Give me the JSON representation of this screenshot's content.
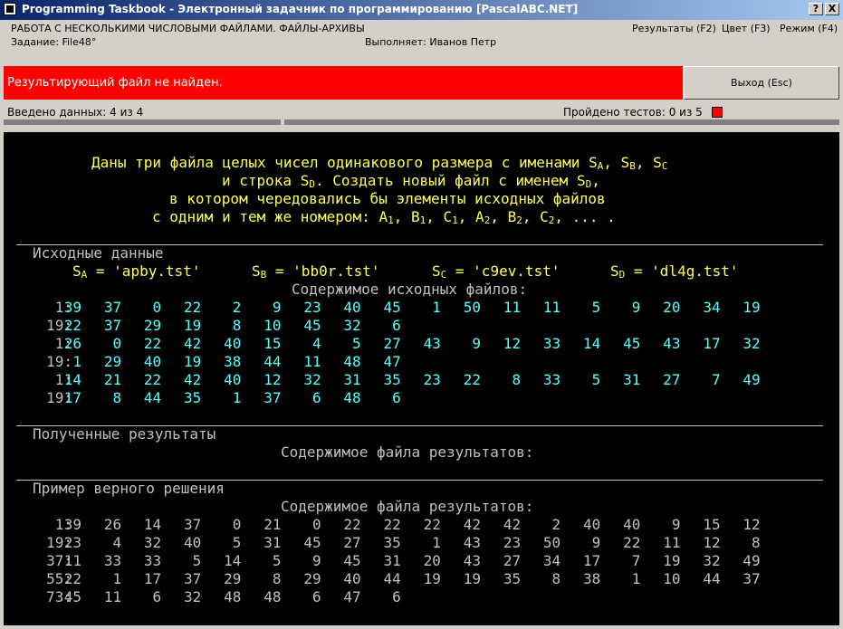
{
  "window": {
    "title": "Programming Taskbook - Электронный задачник по программированию [PascalABC.NET]",
    "help_btn": "?",
    "close_btn": "X"
  },
  "header": {
    "topic": "РАБОТА С НЕСКОЛЬКИМИ ЧИСЛОВЫМИ ФАЙЛАМИ. ФАЙЛЫ-АРХИВЫ",
    "task": "Задание: File48°",
    "performer": "Выполняет: Иванов Петр",
    "menu": [
      "Результаты (F2)",
      "Цвет (F3)",
      "Режим (F4)"
    ]
  },
  "message": "Результирующий файл не найден.",
  "exit_button": "Выход (Esc)",
  "status": {
    "entered": "Введено данных: 4 из 4",
    "tests": "Пройдено тестов: 0 из 5"
  },
  "task_text": [
    [
      "Даны три файла целых чисел одинакового размера с именами S",
      "A",
      ", S",
      "B",
      ", S",
      "C",
      ""
    ],
    [
      "и строка S",
      "D",
      ". Создать новый файл с именем S",
      "D",
      ","
    ],
    [
      "в котором чередовались бы элементы исходных файлов"
    ],
    [
      "с одним и тем же номером: A",
      "1",
      ", B",
      "1",
      ", C",
      "1",
      ", A",
      "2",
      ", B",
      "2",
      ", C",
      "2",
      ", ... ."
    ]
  ],
  "sections": {
    "source": "Исходные данные",
    "results": "Полученные результаты",
    "example": "Пример верного решения"
  },
  "file_names": [
    {
      "label": "S",
      "sub": "A",
      "eq": " = ",
      "value": "'apby.tst'"
    },
    {
      "label": "S",
      "sub": "B",
      "eq": " = ",
      "value": "'bb0r.tst'"
    },
    {
      "label": "S",
      "sub": "C",
      "eq": " = ",
      "value": "'c9ev.tst'"
    },
    {
      "label": "S",
      "sub": "D",
      "eq": " = ",
      "value": "'dl4g.tst'"
    }
  ],
  "source_caption": "Содержимое исходных файлов:",
  "source_rows": [
    {
      "label": "1:",
      "values": [
        "39",
        "37",
        "0",
        "22",
        "2",
        "9",
        "23",
        "40",
        "45",
        "1",
        "50",
        "11",
        "11",
        "5",
        "9",
        "20",
        "34",
        "19"
      ]
    },
    {
      "label": "19:",
      "values": [
        "22",
        "37",
        "29",
        "19",
        "8",
        "10",
        "45",
        "32",
        "6"
      ]
    },
    {
      "label": "1:",
      "values": [
        "26",
        "0",
        "22",
        "42",
        "40",
        "15",
        "4",
        "5",
        "27",
        "43",
        "9",
        "12",
        "33",
        "14",
        "45",
        "43",
        "17",
        "32"
      ]
    },
    {
      "label": "19:",
      "values": [
        "1",
        "29",
        "40",
        "19",
        "38",
        "44",
        "11",
        "48",
        "47"
      ]
    },
    {
      "label": "1:",
      "values": [
        "14",
        "21",
        "22",
        "42",
        "40",
        "12",
        "32",
        "31",
        "35",
        "23",
        "22",
        "8",
        "33",
        "5",
        "31",
        "27",
        "7",
        "49"
      ]
    },
    {
      "label": "19:",
      "values": [
        "17",
        "8",
        "44",
        "35",
        "1",
        "37",
        "6",
        "48",
        "6"
      ]
    }
  ],
  "result_caption": "Содержимое файла результатов:",
  "example_caption": "Содержимое файла результатов:",
  "example_rows": [
    {
      "label": "1:",
      "values": [
        "39",
        "26",
        "14",
        "37",
        "0",
        "21",
        "0",
        "22",
        "22",
        "22",
        "42",
        "42",
        "2",
        "40",
        "40",
        "9",
        "15",
        "12"
      ]
    },
    {
      "label": "19:",
      "values": [
        "23",
        "4",
        "32",
        "40",
        "5",
        "31",
        "45",
        "27",
        "35",
        "1",
        "43",
        "23",
        "50",
        "9",
        "22",
        "11",
        "12",
        "8"
      ]
    },
    {
      "label": "37:",
      "values": [
        "11",
        "33",
        "33",
        "5",
        "14",
        "5",
        "9",
        "45",
        "31",
        "20",
        "43",
        "27",
        "34",
        "17",
        "7",
        "19",
        "32",
        "49"
      ]
    },
    {
      "label": "55:",
      "values": [
        "22",
        "1",
        "17",
        "37",
        "29",
        "8",
        "29",
        "40",
        "44",
        "19",
        "19",
        "35",
        "8",
        "38",
        "1",
        "10",
        "44",
        "37"
      ]
    },
    {
      "label": "73:",
      "values": [
        "45",
        "11",
        "6",
        "32",
        "48",
        "48",
        "6",
        "47",
        "6"
      ]
    }
  ],
  "colors": {
    "titlebar_start": "#0a246a",
    "error_bar": "#ff0000",
    "console_bg": "#000000",
    "text_gray": "#c0c0c0",
    "text_yellow": "#ffff55",
    "text_cyan": "#55ffff"
  }
}
